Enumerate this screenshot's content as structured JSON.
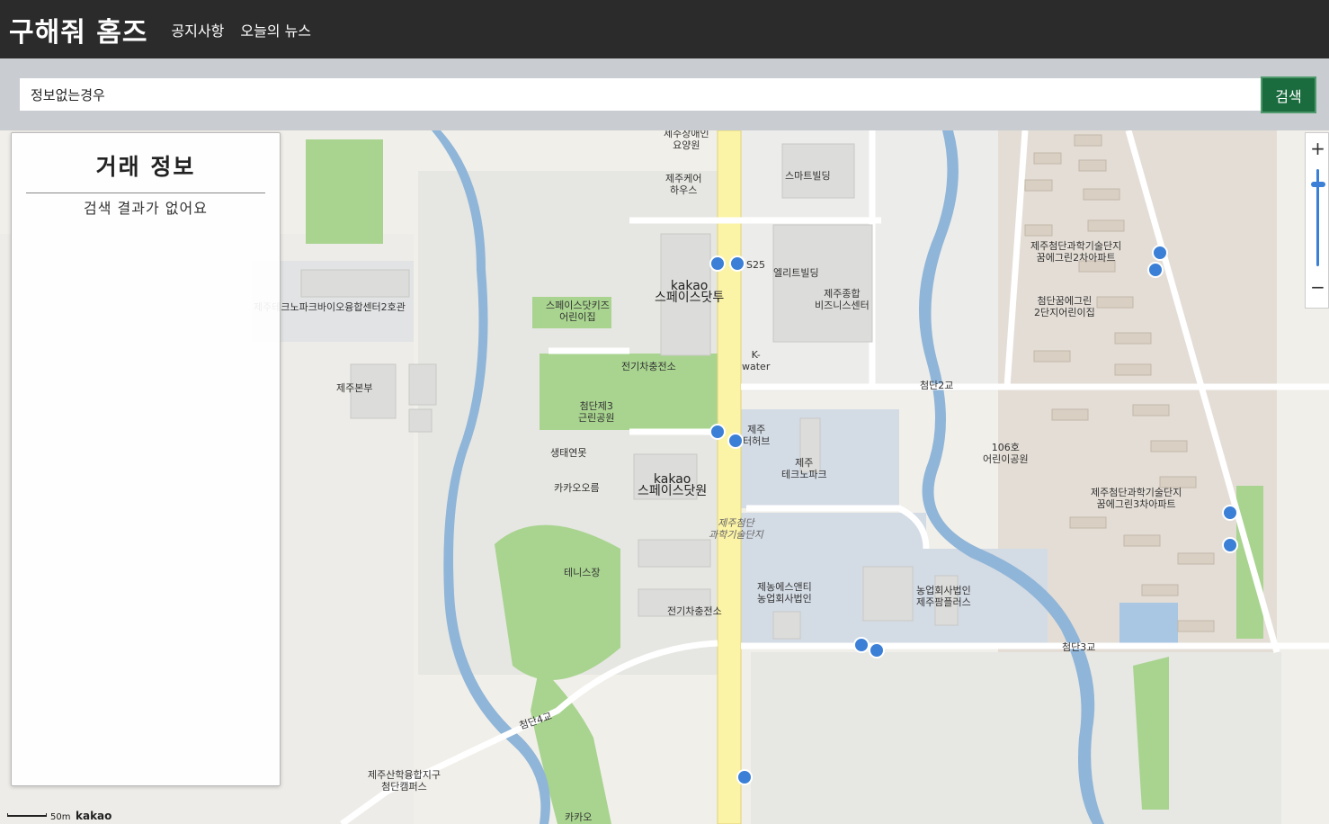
{
  "header": {
    "brand": "구해줘 홈즈",
    "nav": [
      "공지사항",
      "오늘의 뉴스"
    ]
  },
  "search": {
    "value": "정보없는경우",
    "button_label": "검색"
  },
  "panel": {
    "title": "거래 정보",
    "empty_message": "검색 결과가 없어요"
  },
  "map": {
    "labels": [
      "제주장애인\n요양원",
      "제주케어\n하우스",
      "스마트빌딩",
      "엘리트빌딩",
      "제주종합\n비즈니스센터",
      "S25",
      "스페이스닷키즈\n어린이집",
      "kakao\n스페이스닷투",
      "전기차충전소",
      "K-\nwater",
      "첨단2교",
      "제주첨단과학기술단지\n꿈에그린2차아파트",
      "첨단꿈에그린\n2단지어린이집",
      "첨단제3\n근린공원",
      "제주\n터허브",
      "제주\n테크노파크",
      "106호\n어린이공원",
      "생태연못",
      "kakao\n스페이스닷원",
      "카카오오름",
      "제주첨단\n과학기술단지",
      "제주첨단과학기술단지\n꿈에그린3차아파트",
      "테니스장",
      "제농에스앤티\n농업회사법인",
      "농업회사법인\n제주팜플러스",
      "전기차충전소",
      "첨단3교",
      "첨단4교",
      "제주산학융합지구\n첨단캠퍼스",
      "카카오",
      "제주본부",
      "제주테크노파크바이오융합센터2호관"
    ],
    "zoom_in": "+",
    "zoom_out": "−",
    "scale_text": "50m",
    "scale_logo": "kakao"
  },
  "colors": {
    "header_bg": "#2b2b2b",
    "search_btn": "#1a6b3d",
    "map_bg": "#f1efea",
    "park": "#a8d48f",
    "water": "#8fb5d8",
    "road_main": "#fbf3a5"
  }
}
